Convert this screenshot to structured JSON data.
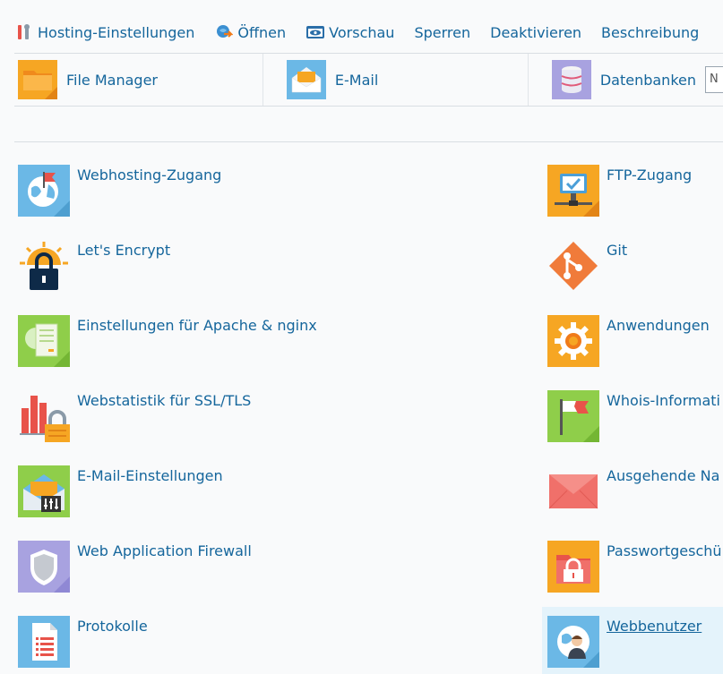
{
  "toolbar": {
    "items": [
      {
        "label": "Hosting-Einstellungen",
        "icon": "wrench-icon"
      },
      {
        "label": "Öffnen",
        "icon": "open-globe-icon"
      },
      {
        "label": "Vorschau",
        "icon": "eye-icon"
      },
      {
        "label": "Sperren"
      },
      {
        "label": "Deaktivieren"
      },
      {
        "label": "Beschreibung"
      }
    ]
  },
  "shortcuts": {
    "file_manager": "File Manager",
    "email": "E-Mail",
    "databases": "Datenbanken",
    "input_value": "N"
  },
  "tools": {
    "left": [
      {
        "label": "Webhosting-Zugang",
        "icon": "globe-flag-icon"
      },
      {
        "label": "Let's Encrypt",
        "icon": "lock-sun-icon"
      },
      {
        "label": "Einstellungen für Apache & nginx",
        "icon": "server-config-icon"
      },
      {
        "label": "Webstatistik für SSL/TLS",
        "icon": "stats-lock-icon"
      },
      {
        "label": "E-Mail-Einstellungen",
        "icon": "mail-settings-icon"
      },
      {
        "label": "Web Application Firewall",
        "icon": "shield-icon"
      },
      {
        "label": "Protokolle",
        "icon": "document-log-icon"
      }
    ],
    "right": [
      {
        "label": "FTP-Zugang",
        "icon": "ftp-monitor-icon"
      },
      {
        "label": "Git",
        "icon": "git-icon"
      },
      {
        "label": "Anwendungen",
        "icon": "gear-icon"
      },
      {
        "label": "Whois-Informati",
        "icon": "whois-flag-icon"
      },
      {
        "label": "Ausgehende Na",
        "icon": "envelope-icon"
      },
      {
        "label": "Passwortgeschü",
        "icon": "folder-lock-icon"
      },
      {
        "label": "Webbenutzer",
        "icon": "web-user-icon"
      }
    ]
  },
  "colors": {
    "link": "#15669c",
    "active_bg": "#e4f3fb"
  }
}
